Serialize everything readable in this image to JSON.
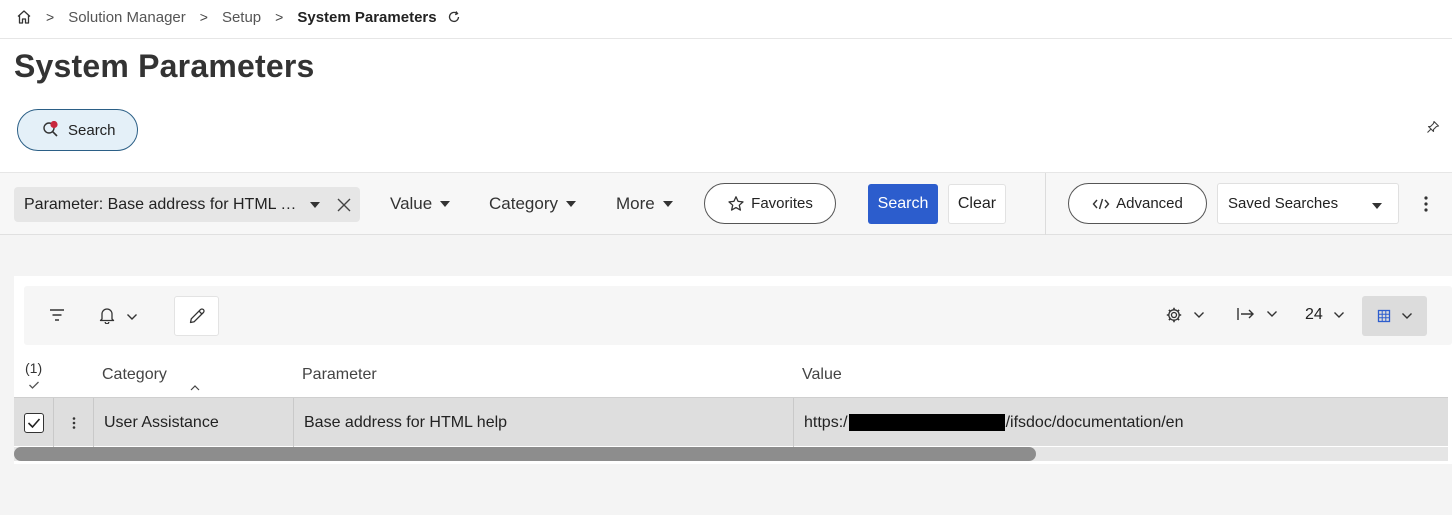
{
  "breadcrumb": {
    "items": [
      "Solution Manager",
      "Setup"
    ],
    "current": "System Parameters"
  },
  "page": {
    "title": "System Parameters"
  },
  "search_toggle": {
    "label": "Search"
  },
  "filter": {
    "chip_label": "Parameter: Base address for HTML help",
    "dropdowns": [
      "Value",
      "Category",
      "More"
    ],
    "favorites_label": "Favorites",
    "search_label": "Search",
    "clear_label": "Clear",
    "advanced_label": "Advanced",
    "saved_searches_label": "Saved Searches"
  },
  "toolbar": {
    "page_size": "24"
  },
  "table": {
    "selected_count": "(1)",
    "columns": [
      "Category",
      "Parameter",
      "Value"
    ],
    "rows": [
      {
        "category": "User Assistance",
        "parameter": "Base address for HTML help",
        "value_prefix": "https:/",
        "value_suffix": "/ifsdoc/documentation/en"
      }
    ]
  },
  "colors": {
    "primary": "#2c5dcd",
    "pill_border": "#2b5f86",
    "pill_bg": "#e4f0f8",
    "row_selected": "#dedede"
  }
}
